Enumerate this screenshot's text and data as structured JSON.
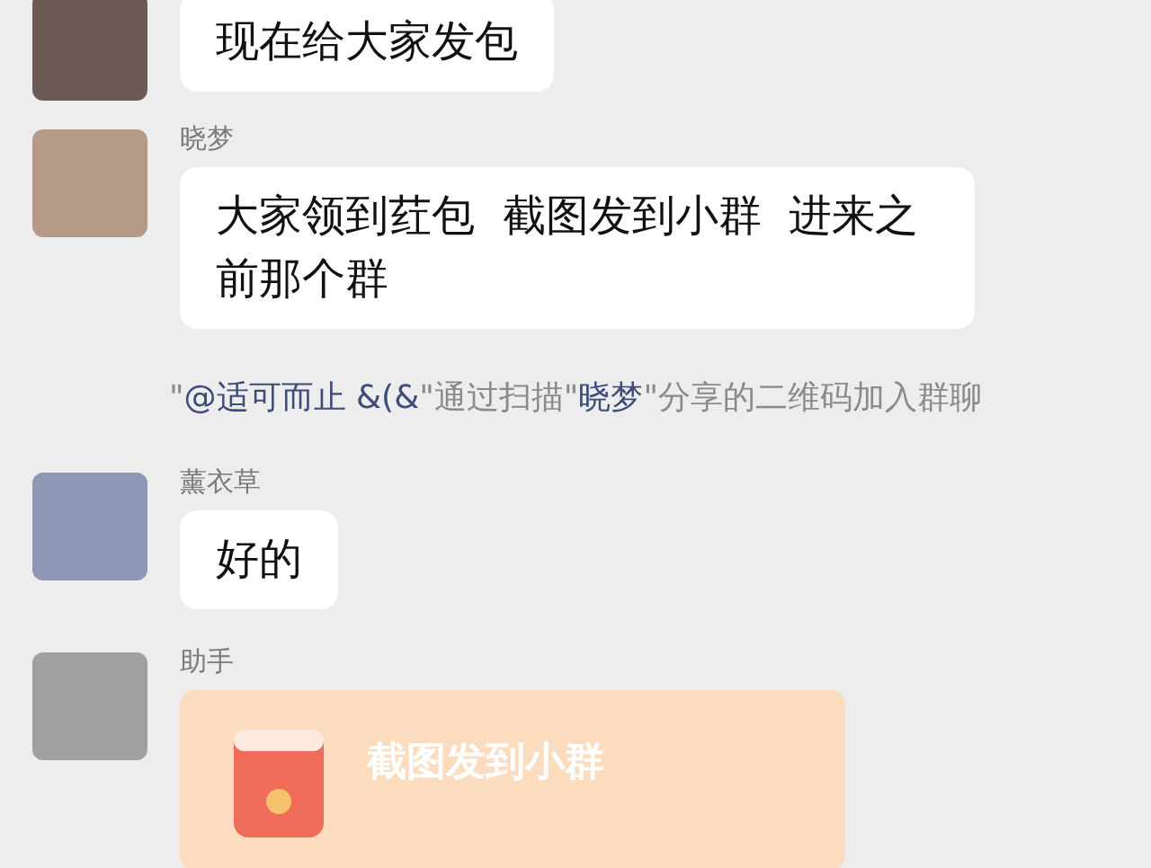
{
  "messages": [
    {
      "kind": "text",
      "text": "现在给大家发包"
    },
    {
      "kind": "text",
      "sender": "晓梦",
      "text": "大家领到荭包  截图发到小群  进来之前那个群"
    },
    {
      "kind": "system",
      "segments": [
        {
          "kind": "plain",
          "text": "\""
        },
        {
          "kind": "mention",
          "text": "@适可而止 &(&"
        },
        {
          "kind": "plain",
          "text": "\"通过扫描\""
        },
        {
          "kind": "mention",
          "text": "晓梦"
        },
        {
          "kind": "plain",
          "text": "\"分享的二维码加入群聊"
        }
      ]
    },
    {
      "kind": "text",
      "sender": "薰衣草",
      "text": "好的"
    },
    {
      "kind": "packet",
      "sender": "助手",
      "text": "截图发到小群"
    }
  ]
}
